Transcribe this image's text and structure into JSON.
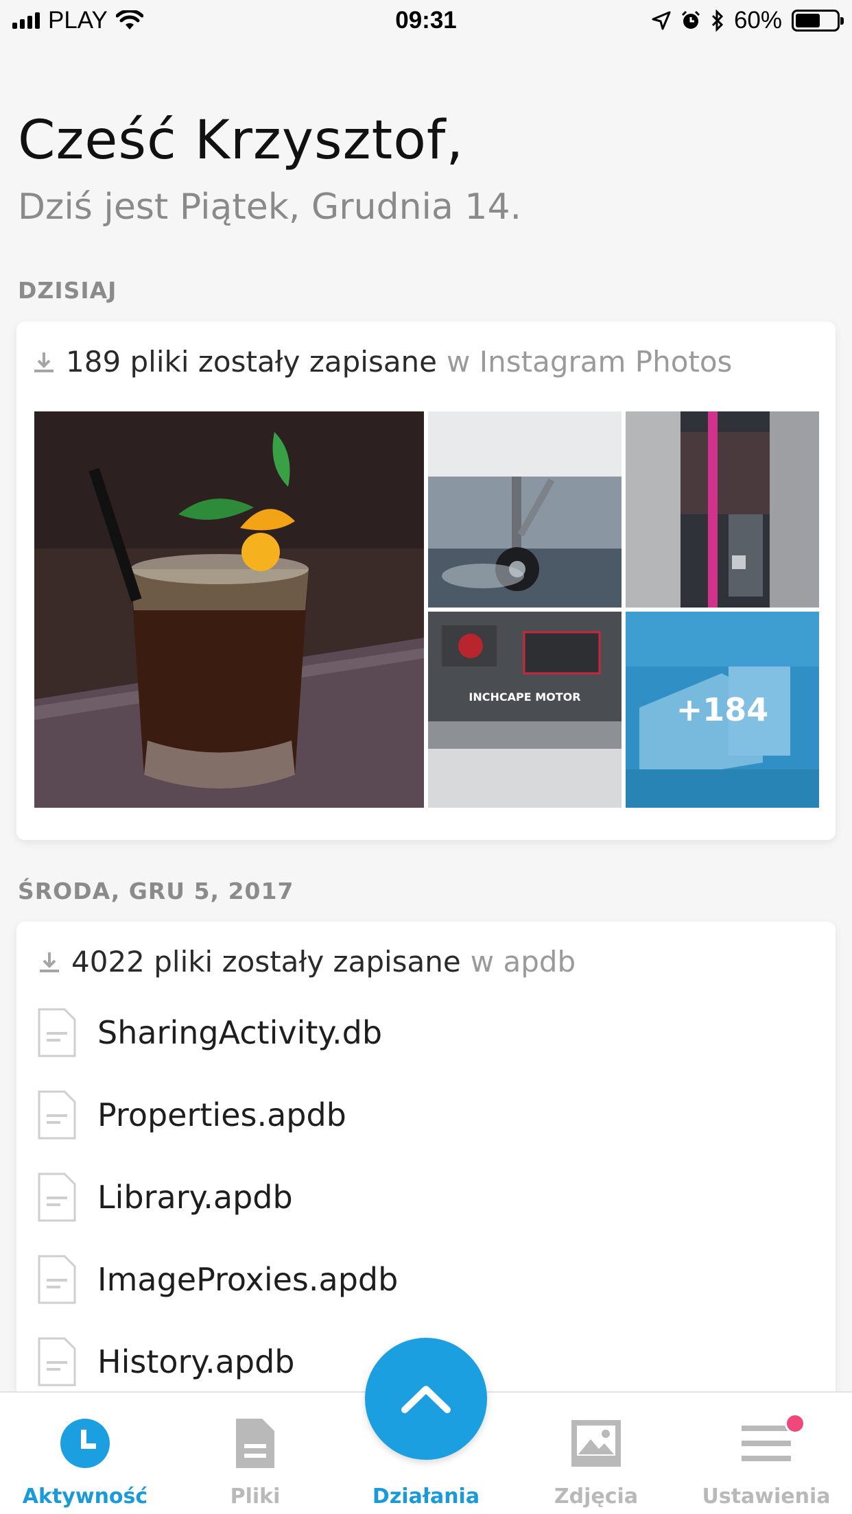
{
  "status_bar": {
    "carrier": "PLAY",
    "time": "09:31",
    "battery": "60%",
    "battery_level": 0.6
  },
  "greeting": {
    "title": "Cześć Krzysztof,",
    "subtitle": "Dziś jest Piątek, Grudnia 14."
  },
  "sections": [
    {
      "label": "DZISIAJ",
      "card": {
        "count_text": "189 pliki zostały zapisane",
        "location_text": "w Instagram Photos",
        "more_count": "+184"
      }
    },
    {
      "label": "ŚRODA, GRU 5, 2017",
      "card": {
        "count_text": "4022 pliki zostały zapisane",
        "location_text": "w apdb",
        "files": [
          "SharingActivity.db",
          "Properties.apdb",
          "Library.apdb",
          "ImageProxies.apdb",
          "History.apdb"
        ]
      }
    }
  ],
  "tabs": [
    {
      "label": "Aktywność",
      "icon": "clock-icon",
      "active": true
    },
    {
      "label": "Pliki",
      "icon": "document-icon",
      "active": false
    },
    {
      "label": "Działania",
      "icon": "chevron-up-icon",
      "active": true
    },
    {
      "label": "Zdjęcia",
      "icon": "image-icon",
      "active": false
    },
    {
      "label": "Ustawienia",
      "icon": "menu-icon",
      "active": false
    }
  ],
  "colors": {
    "accent": "#1b9fe0",
    "badge": "#f0487a",
    "muted": "#8a8a8a"
  }
}
